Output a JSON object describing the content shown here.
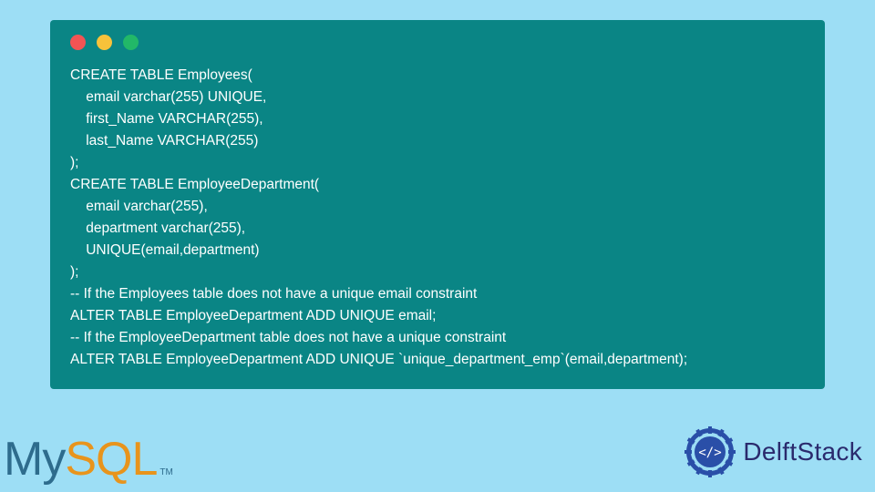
{
  "code": {
    "lines": [
      "CREATE TABLE Employees(",
      "    email varchar(255) UNIQUE,",
      "    first_Name VARCHAR(255),",
      "    last_Name VARCHAR(255)",
      ");",
      "CREATE TABLE EmployeeDepartment(",
      "    email varchar(255),",
      "    department varchar(255),",
      "    UNIQUE(email,department)",
      ");",
      "-- If the Employees table does not have a unique email constraint",
      "ALTER TABLE EmployeeDepartment ADD UNIQUE email;",
      "-- If the EmployeeDepartment table does not have a unique constraint",
      "ALTER TABLE EmployeeDepartment ADD UNIQUE `unique_department_emp`(email,department);"
    ]
  },
  "logos": {
    "mysql_my": "My",
    "mysql_sql": "SQL",
    "mysql_tm": "TM",
    "delftstack": "DelftStack"
  }
}
